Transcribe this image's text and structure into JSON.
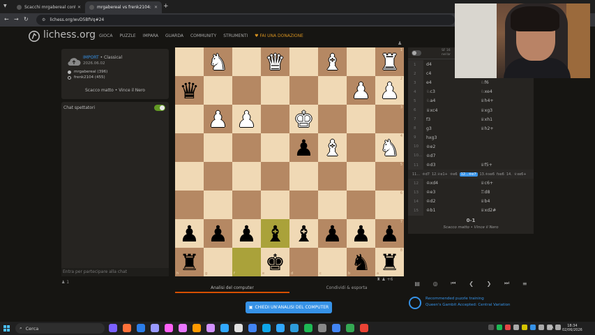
{
  "browser": {
    "tabs": [
      {
        "title": "Scacchi mrgabereal contro fren"
      },
      {
        "title": "mrgabereal vs frenk2104: Quee"
      }
    ],
    "url": "lichess.org/wvD5BfVq#24"
  },
  "site": {
    "logo": "lichess.org",
    "nav": [
      "GIOCA",
      "PUZZLE",
      "IMPARA",
      "GUARDA",
      "COMMUNITY",
      "STRUMENTI"
    ],
    "donate": "FAI UNA DONAZIONE"
  },
  "game_meta": {
    "import_label": "IMPORT",
    "mode": " • Classical",
    "date": "2026.06.02",
    "white_player": "mrgabereal (396)",
    "black_player": "frenk2104 (455)",
    "result": "Scacco matto • Vince il Nero"
  },
  "chat": {
    "header": "Chat spettatori",
    "placeholder": "Entra per partecipare alla chat",
    "spectators": "1"
  },
  "board": {
    "light": "#f0d9b5",
    "dark": "#b58863",
    "rows": [
      [
        "",
        "♞w",
        "",
        "♛w",
        "",
        "♝w",
        "",
        "♜w"
      ],
      [
        "♛b",
        "",
        "",
        "",
        "",
        "",
        "♟w",
        "♟w"
      ],
      [
        "",
        "♟w",
        "♟w",
        "",
        "♚w",
        "",
        "",
        ""
      ],
      [
        "",
        "",
        "",
        "",
        "♟b",
        "♝w",
        "",
        "♞w"
      ],
      [
        "",
        "",
        "",
        "",
        "",
        "",
        "",
        ""
      ],
      [
        "",
        "",
        "",
        "",
        "",
        "",
        "",
        ""
      ],
      [
        "♟b",
        "♟b",
        "♟b",
        "♝b",
        "♝b",
        "♟b",
        "♟b",
        "♟b"
      ],
      [
        "♜b",
        "",
        "",
        "♚b",
        "",
        "",
        "♞b",
        "♜b"
      ]
    ],
    "highlight": [
      [
        6,
        3
      ],
      [
        7,
        2
      ]
    ],
    "ranks": [
      "1",
      "2",
      "3",
      "4",
      "5",
      "6",
      "7",
      "8"
    ],
    "files": [
      "h",
      "g",
      "f",
      "e",
      "d",
      "c",
      "b",
      "a"
    ]
  },
  "below_board": {
    "tab_analysis": "Analisi del computer",
    "tab_share": "Condividi & esporta",
    "request_button": "CHIEDI UN'ANALISI DEL COMPUTER",
    "material": "+6"
  },
  "engine": {
    "label_top": "SF 16",
    "label_bot": "nel br"
  },
  "moves": [
    {
      "n": "1",
      "w": "d4",
      "b": "e5"
    },
    {
      "n": "2",
      "w": "c4",
      "b": "exd4"
    },
    {
      "n": "3",
      "w": "e4",
      "b": "♘f6"
    },
    {
      "n": "4",
      "w": "♘c3",
      "b": "♘xe4"
    },
    {
      "n": "5",
      "w": "♘a4",
      "b": "♕h4+"
    },
    {
      "n": "6",
      "w": "♕xc4",
      "b": "♕xg3"
    },
    {
      "n": "7",
      "w": "f3",
      "b": "♕xh1"
    },
    {
      "n": "8",
      "w": "g3",
      "b": "♕h2+"
    },
    {
      "n": "9",
      "w": "hxg3",
      "b": ""
    },
    {
      "n": "10",
      "w": "♔e2",
      "b": ""
    }
  ],
  "moves_mid": {
    "n": "10...",
    "w": "♔d7"
  },
  "moves_line2": {
    "n": "11",
    "w": "♔d3",
    "b": "♕f5+"
  },
  "variation": [
    "11...",
    "♔d7",
    "12.♕e1+",
    "♔e6",
    "12...♔e7",
    "13.♔xe6",
    "fxe6",
    "14.",
    "♕xe6+"
  ],
  "moves_after": [
    {
      "n": "12",
      "w": "♔xd4",
      "b": "♕c6+"
    },
    {
      "n": "13",
      "w": "♔e3",
      "b": "♖d8"
    },
    {
      "n": "14",
      "w": "♔d2",
      "b": "♕b4"
    },
    {
      "n": "15",
      "w": "♔b1",
      "b": "♕xd2#"
    }
  ],
  "final_score": "0-1",
  "final_text": "Scacco matto • Vince il Nero",
  "puzzle": {
    "line1": "Recommended puzzle training",
    "line2": "Queen's Gambit Accepted: Central Variation"
  },
  "taskbar": {
    "search": "Cerca",
    "lang": "ITA",
    "time": "18:34",
    "date": "02/06/2026"
  }
}
